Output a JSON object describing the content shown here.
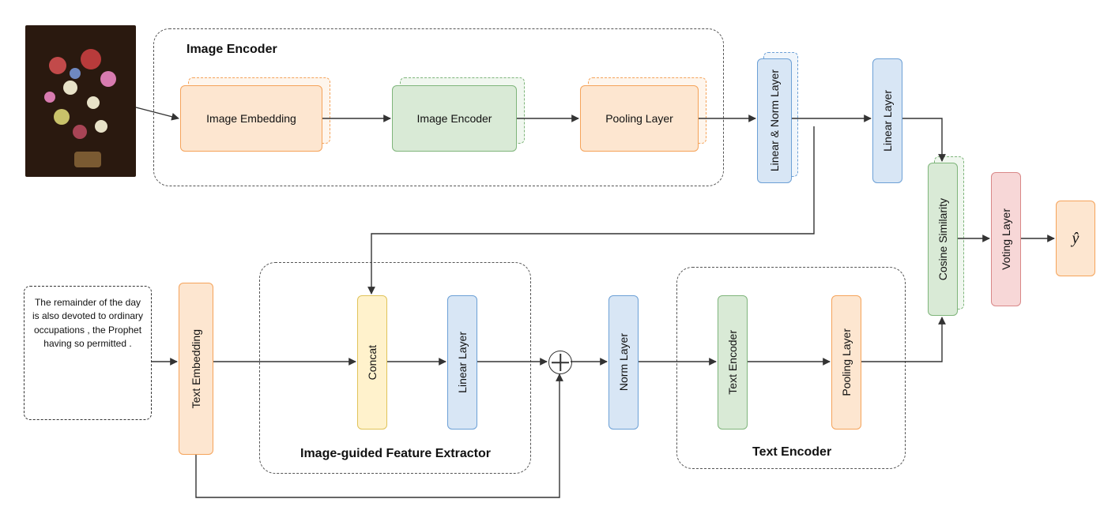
{
  "input_text": "The remainder of the day is also devoted to ordinary occupations , the Prophet having so permitted .",
  "groups": {
    "image_encoder": "Image Encoder",
    "igfe": "Image-guided Feature Extractor",
    "text_encoder": "Text Encoder"
  },
  "blocks": {
    "img_embed": "Image Embedding",
    "img_enc": "Image Encoder",
    "img_pool": "Pooling Layer",
    "lin_norm": "Linear & Norm Layer",
    "lin1": "Linear Layer",
    "cos": "Cosine Similarity",
    "voting": "Voting Layer",
    "yhat": "ŷ",
    "txt_embed": "Text Embedding",
    "concat": "Concat",
    "lin2": "Linear Layer",
    "norm": "Norm Layer",
    "txt_enc": "Text Encoder",
    "txt_pool": "Pooling Layer"
  }
}
